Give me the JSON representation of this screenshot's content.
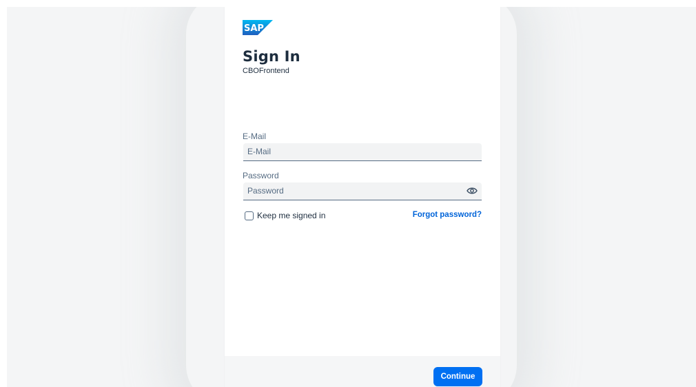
{
  "brand": {
    "logo_text": "SAP",
    "logo_color": "#1ba1e2"
  },
  "form": {
    "title": "Sign In",
    "subtitle": "CBOFrontend",
    "email_label": "E-Mail",
    "email_placeholder": "E-Mail",
    "email_value": "",
    "password_label": "Password",
    "password_placeholder": "Password",
    "password_value": "",
    "keep_signed_in_label": "Keep me signed in",
    "keep_signed_in_checked": false,
    "forgot_password_label": "Forgot password?"
  },
  "footer": {
    "continue_label": "Continue"
  },
  "colors": {
    "accent": "#0070f2",
    "link": "#0064d9",
    "text": "#1d2d3e"
  },
  "icons": {
    "password_toggle": "eye-icon"
  }
}
